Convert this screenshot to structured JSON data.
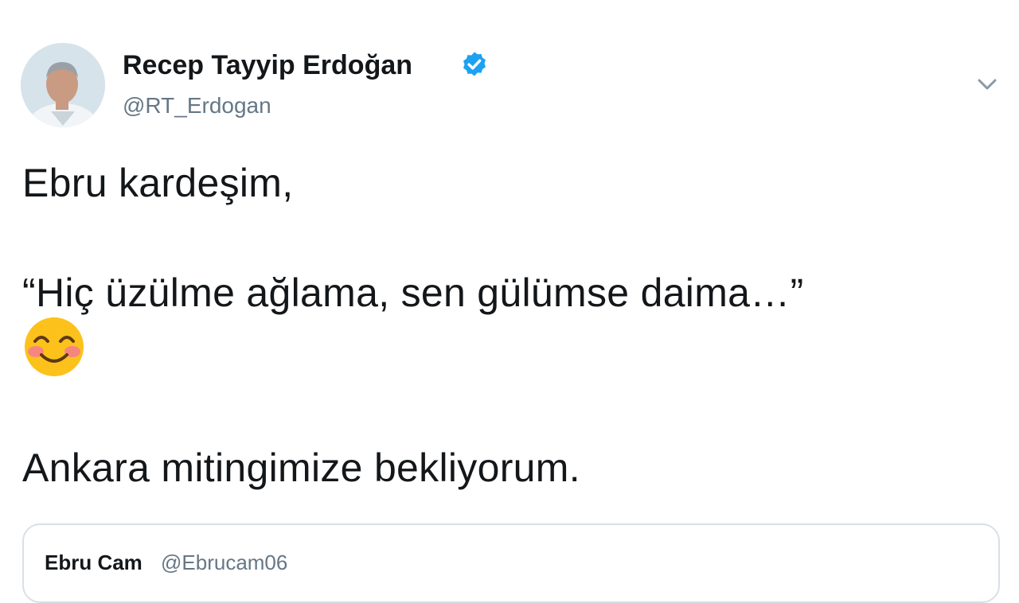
{
  "tweet": {
    "author_name": "Recep Tayyip Erdoğan",
    "author_handle": "@RT_Erdogan",
    "verified": true,
    "body_lines": [
      "Ebru kardeşim,",
      "“Hiç üzülme ağlama, sen gülümse daima…”",
      "Ankara mitingimize bekliyorum."
    ],
    "emoji": "smiling-face-with-smiling-eyes",
    "quoted": {
      "author_name": "Ebru Cam",
      "author_handle": "@Ebrucam06"
    }
  },
  "colors": {
    "text": "#14171a",
    "secondary_text": "#657786",
    "verified_blue": "#1da1f2",
    "border": "#d8e0e6"
  }
}
